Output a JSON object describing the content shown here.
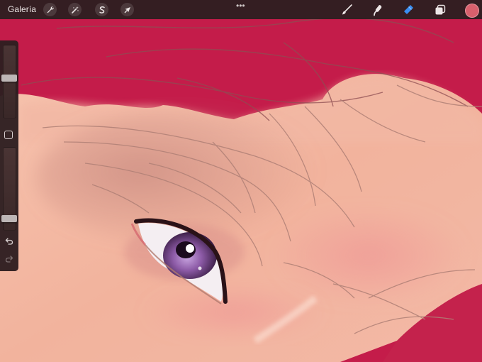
{
  "topbar": {
    "gallery_label": "Galería",
    "left_tools": [
      {
        "icon": "wrench-icon",
        "name": "actions-button"
      },
      {
        "icon": "magic-wand-icon",
        "name": "adjustments-button"
      },
      {
        "icon": "selection-s-icon",
        "name": "selection-button"
      },
      {
        "icon": "transform-arrow-icon",
        "name": "transform-button"
      }
    ],
    "more_label": "•••",
    "right_tools": [
      {
        "icon": "brush-icon",
        "name": "brush-button"
      },
      {
        "icon": "smudge-icon",
        "name": "smudge-button"
      },
      {
        "icon": "eraser-icon",
        "name": "eraser-button"
      },
      {
        "icon": "layers-icon",
        "name": "layers-button"
      }
    ],
    "active_color": "#d8606c",
    "active_tool_color": "#3a8ef0"
  },
  "sidebar": {
    "brush_size_level": 0.55,
    "opacity_level": 0.1
  },
  "colors": {
    "hair": "#c41c4a",
    "skin": "#f0b49e",
    "iris": "#8c5aa6"
  }
}
